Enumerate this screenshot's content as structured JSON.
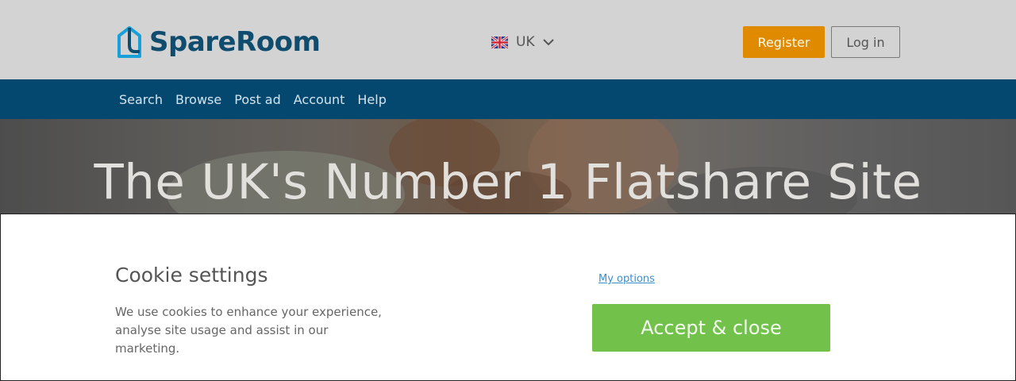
{
  "header": {
    "logo": {
      "text": "SpareRoom",
      "icon": "house-logo-icon",
      "color": "#0f4c6e",
      "accent": "#1aa0d8"
    },
    "locale": {
      "label": "UK",
      "flag_icon": "uk-flag-icon",
      "chevron_icon": "chevron-down-icon"
    },
    "register_label": "Register",
    "login_label": "Log in",
    "colors": {
      "background": "#d3d3d3",
      "register": "#e08a00"
    }
  },
  "nav": {
    "background": "#044870",
    "items": [
      {
        "label": "Search"
      },
      {
        "label": "Browse"
      },
      {
        "label": "Post ad"
      },
      {
        "label": "Account"
      },
      {
        "label": "Help"
      }
    ]
  },
  "hero": {
    "title": "The UK's Number 1 Flatshare Site"
  },
  "cookie_banner": {
    "title": "Cookie settings",
    "text": "We use cookies to enhance your experience, analyse site usage and assist in our marketing.",
    "options_link": "My options",
    "accept_label": "Accept & close",
    "accept_color": "#71c14a"
  }
}
